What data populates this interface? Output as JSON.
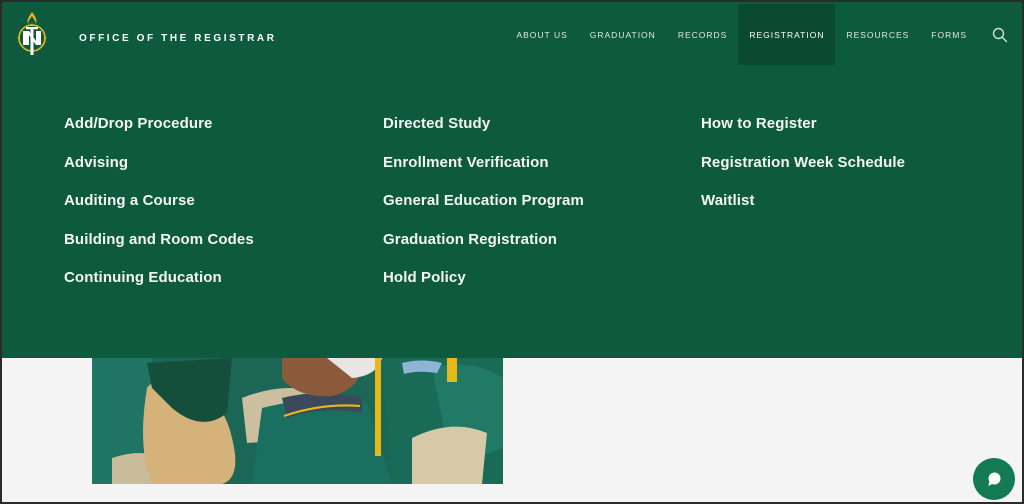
{
  "header": {
    "site_title": "OFFICE OF THE REGISTRAR",
    "logo_icon": "northern-state-university-logo",
    "brand_color": "#0d5a3e",
    "accent_color": "#e8b818"
  },
  "nav": {
    "items": [
      {
        "label": "ABOUT US",
        "active": false
      },
      {
        "label": "GRADUATION",
        "active": false
      },
      {
        "label": "RECORDS",
        "active": false
      },
      {
        "label": "REGISTRATION",
        "active": true
      },
      {
        "label": "RESOURCES",
        "active": false
      },
      {
        "label": "FORMS",
        "active": false
      }
    ],
    "search_icon": "search-icon"
  },
  "megamenu": {
    "columns": [
      [
        "Add/Drop Procedure",
        "Advising",
        "Auditing a Course",
        "Building and Room Codes",
        "Continuing Education"
      ],
      [
        "Directed Study",
        "Enrollment Verification",
        "General Education Program",
        "Graduation Registration",
        "Hold Policy"
      ],
      [
        "How to Register",
        "Registration Week Schedule",
        "Waitlist"
      ]
    ]
  },
  "hero": {
    "image_description": "Graduates in green gowns and caps with gold tassels seated in chairs"
  },
  "chat": {
    "icon": "chat-bubble-icon"
  }
}
